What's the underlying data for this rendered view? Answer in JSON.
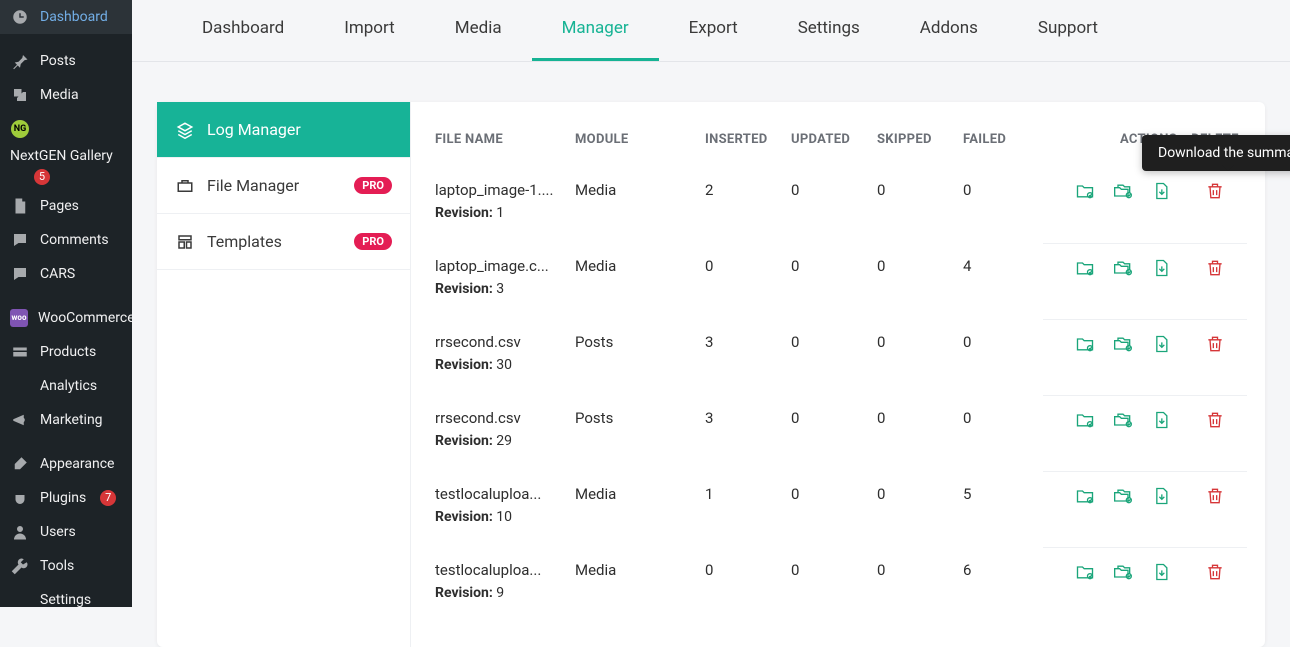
{
  "sidebar": {
    "items": [
      {
        "label": "Dashboard"
      },
      {
        "label": "Posts"
      },
      {
        "label": "Media"
      },
      {
        "label": "NextGEN Gallery",
        "sub_badge": "5"
      },
      {
        "label": "Pages"
      },
      {
        "label": "Comments"
      },
      {
        "label": "CARS"
      },
      {
        "label": "WooCommerce"
      },
      {
        "label": "Products"
      },
      {
        "label": "Analytics"
      },
      {
        "label": "Marketing"
      },
      {
        "label": "Appearance"
      },
      {
        "label": "Plugins",
        "badge": "7"
      },
      {
        "label": "Users"
      },
      {
        "label": "Tools"
      },
      {
        "label": "Settings"
      }
    ]
  },
  "tabs": {
    "items": [
      {
        "label": "Dashboard"
      },
      {
        "label": "Import"
      },
      {
        "label": "Media"
      },
      {
        "label": "Manager",
        "active": true
      },
      {
        "label": "Export"
      },
      {
        "label": "Settings"
      },
      {
        "label": "Addons"
      },
      {
        "label": "Support"
      }
    ]
  },
  "subnav": {
    "items": [
      {
        "label": "Log Manager",
        "active": true
      },
      {
        "label": "File Manager",
        "pro": true
      },
      {
        "label": "Templates",
        "pro": true
      }
    ],
    "pro_label": "PRO"
  },
  "table": {
    "headers": {
      "file": "FILE NAME",
      "module": "MODULE",
      "inserted": "INSERTED",
      "updated": "UPDATED",
      "skipped": "SKIPPED",
      "failed": "FAILED",
      "actions": "ACTIONS",
      "delete": "DELETE"
    },
    "revision_label": "Revision:",
    "rows": [
      {
        "file": "laptop_image-1....",
        "module": "Media",
        "inserted": "2",
        "updated": "0",
        "skipped": "0",
        "failed": "0",
        "revision": "1"
      },
      {
        "file": "laptop_image.c...",
        "module": "Media",
        "inserted": "0",
        "updated": "0",
        "skipped": "0",
        "failed": "4",
        "revision": "3"
      },
      {
        "file": "rrsecond.csv",
        "module": "Posts",
        "inserted": "3",
        "updated": "0",
        "skipped": "0",
        "failed": "0",
        "revision": "30"
      },
      {
        "file": "rrsecond.csv",
        "module": "Posts",
        "inserted": "3",
        "updated": "0",
        "skipped": "0",
        "failed": "0",
        "revision": "29"
      },
      {
        "file": "testlocaluploa...",
        "module": "Media",
        "inserted": "1",
        "updated": "0",
        "skipped": "0",
        "failed": "5",
        "revision": "10"
      },
      {
        "file": "testlocaluploa...",
        "module": "Media",
        "inserted": "0",
        "updated": "0",
        "skipped": "0",
        "failed": "6",
        "revision": "9"
      }
    ]
  },
  "tooltip": "Download the summary log"
}
